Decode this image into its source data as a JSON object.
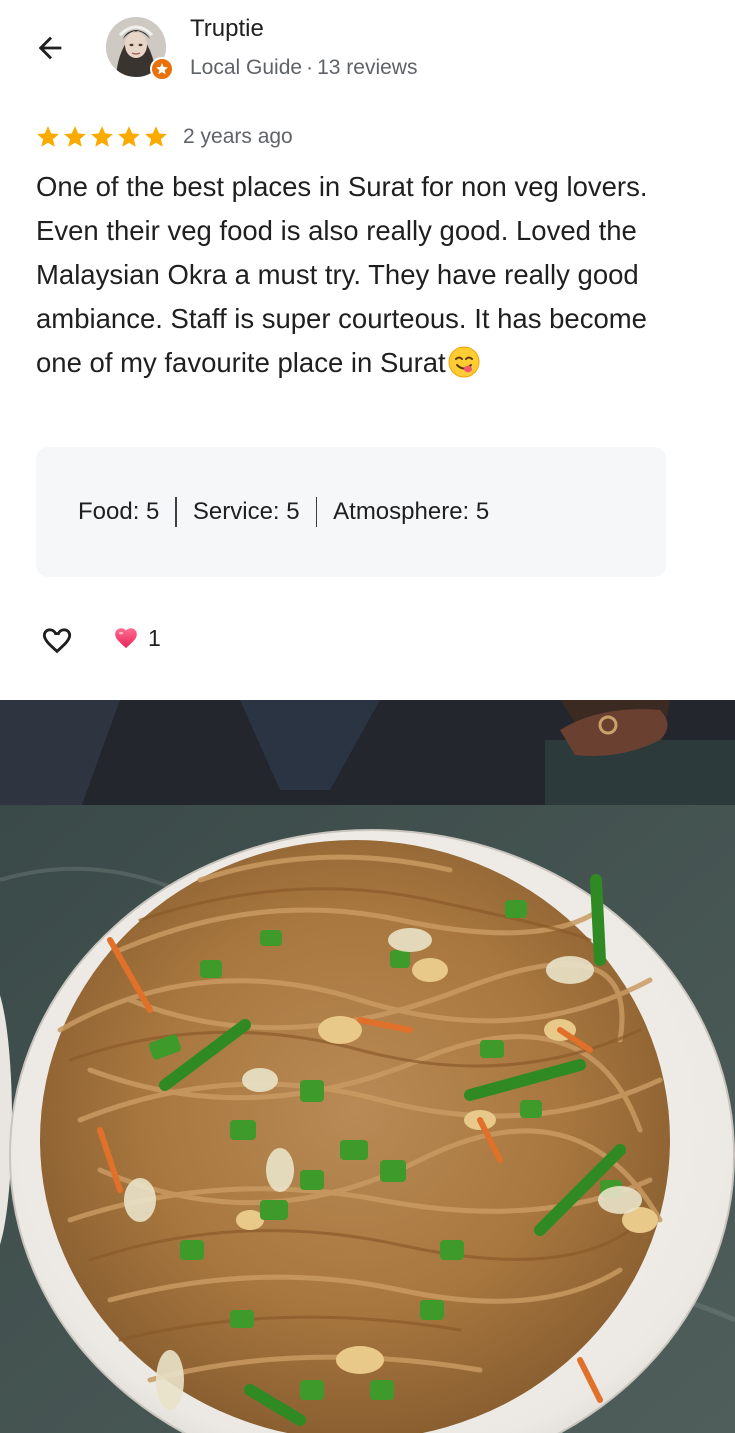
{
  "reviewer": {
    "name": "Truptie",
    "badge": "Local Guide",
    "separator": "·",
    "reviews_count": "13 reviews"
  },
  "review": {
    "rating": 5,
    "age": "2 years ago",
    "text": "One of the best places in Surat for non veg lovers. Even their veg food is also really good. Loved the Malaysian Okra a must try. They have really good ambiance. Staff is super courteous. It has become one of my favourite place in Surat",
    "emoji": "face-savoring-food"
  },
  "sub_ratings": [
    {
      "label": "Food:",
      "value": "5"
    },
    {
      "label": "Service:",
      "value": "5"
    },
    {
      "label": "Atmosphere:",
      "value": "5"
    }
  ],
  "reactions": {
    "like_icon": "heart-outline-icon",
    "reaction_icon": "pink-heart-icon",
    "count": "1"
  },
  "photo": {
    "subject": "plate of stir-fried hakka noodles"
  },
  "colors": {
    "star": "#f9ab00",
    "guide_badge": "#e8710a",
    "text_primary": "#1f1f1f",
    "text_secondary": "#5f6368",
    "card_bg": "#f6f7f9",
    "heart_pink": "#f43f72"
  }
}
